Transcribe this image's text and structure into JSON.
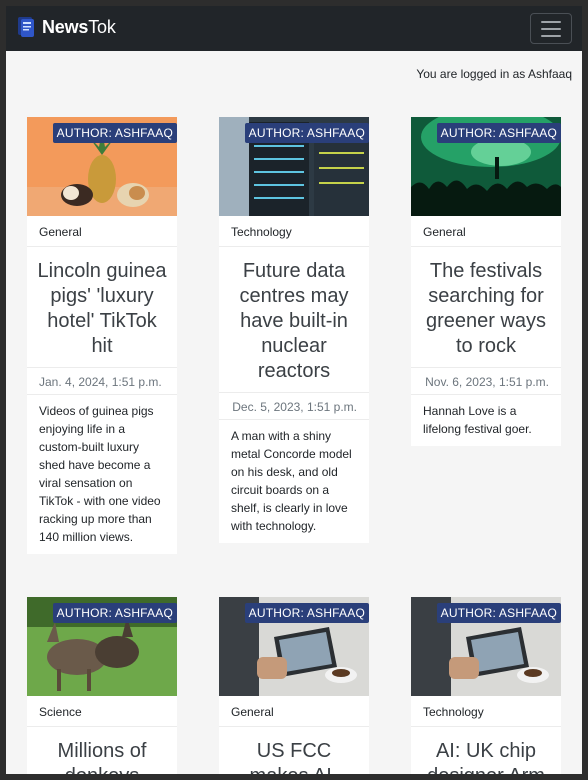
{
  "navbar": {
    "brand_bold": "News",
    "brand_light": "Tok"
  },
  "header": {
    "login_text": "You are logged in as Ashfaaq"
  },
  "cards": [
    {
      "badge": "AUTHOR: ASHFAAQ",
      "category": "General",
      "title": "Lincoln guinea pigs' 'luxury hotel' TikTok hit",
      "date": "Jan. 4, 2024, 1:51 p.m.",
      "description": "Videos of guinea pigs enjoying life in a custom-built luxury shed have become a viral sensation on TikTok - with one video racking up more than 140 million views."
    },
    {
      "badge": "AUTHOR: ASHFAAQ",
      "category": "Technology",
      "title": "Future data centres may have built-in nuclear reactors",
      "date": "Dec. 5, 2023, 1:51 p.m.",
      "description": "A man with a shiny metal Concorde model on his desk, and old circuit boards on a shelf, is clearly in love with technology."
    },
    {
      "badge": "AUTHOR: ASHFAAQ",
      "category": "General",
      "title": "The festivals searching for greener ways to rock",
      "date": "Nov. 6, 2023, 1:51 p.m.",
      "description": "Hannah Love is a lifelong festival goer."
    },
    {
      "badge": "AUTHOR: ASHFAAQ",
      "category": "Science",
      "title": "Millions of donkeys"
    },
    {
      "badge": "AUTHOR: ASHFAAQ",
      "category": "General",
      "title": "US FCC makes AI-"
    },
    {
      "badge": "AUTHOR: ASHFAAQ",
      "category": "Technology",
      "title": "AI: UK chip designer Arm"
    }
  ]
}
